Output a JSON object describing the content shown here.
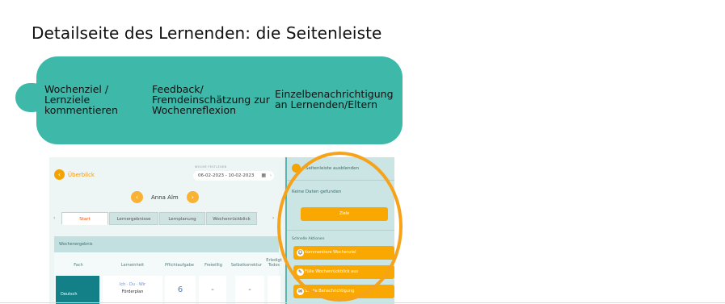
{
  "slide": {
    "title": "Detailseite des Lernenden: die Seitenleiste"
  },
  "callouts": [
    "Wochenziel / Lernziele kommentieren",
    "Feedback/ Fremdeinschätzung zur Wochenreflexion",
    "Einzelbenachrichtigung an Lernenden/Eltern"
  ],
  "app": {
    "back_label": "Überblick",
    "week_caption": "WOCHE FESTLEGEN",
    "date_range": "06-02-2023 - 10-02-2023",
    "learner_name": "Anna Alm",
    "tabs": [
      "Start",
      "Lernergebnisse",
      "Lernplanung",
      "Wochenrückblick"
    ],
    "week_section_title": "Wochenergebnis",
    "columns": [
      "Fach",
      "Lerneinheit",
      "Pflichtaufgabe",
      "Freiwillig",
      "Selbstkorrektur",
      "Erledigt",
      "Todos"
    ],
    "row": {
      "subject": "Deutsch",
      "unit_line1": "Ich · Du · Wir",
      "unit_line2": "Förderplan",
      "pflicht": "6",
      "freiwillig": "-",
      "selbstkorrektur": "-"
    }
  },
  "sidebar": {
    "hide_label": "Seitenleiste ausblenden",
    "no_data": "Keine Daten gefunden",
    "goal_button": "Ziele",
    "quick_actions_label": "Schnelle Aktionen",
    "actions": [
      "Kommentiere Wochenziel",
      "Fülle Wochenrückblick aus",
      "Sende Benachrichtigung"
    ]
  },
  "colors": {
    "teal_bubble": "#3db8a9",
    "accent_orange": "#f5a300"
  }
}
